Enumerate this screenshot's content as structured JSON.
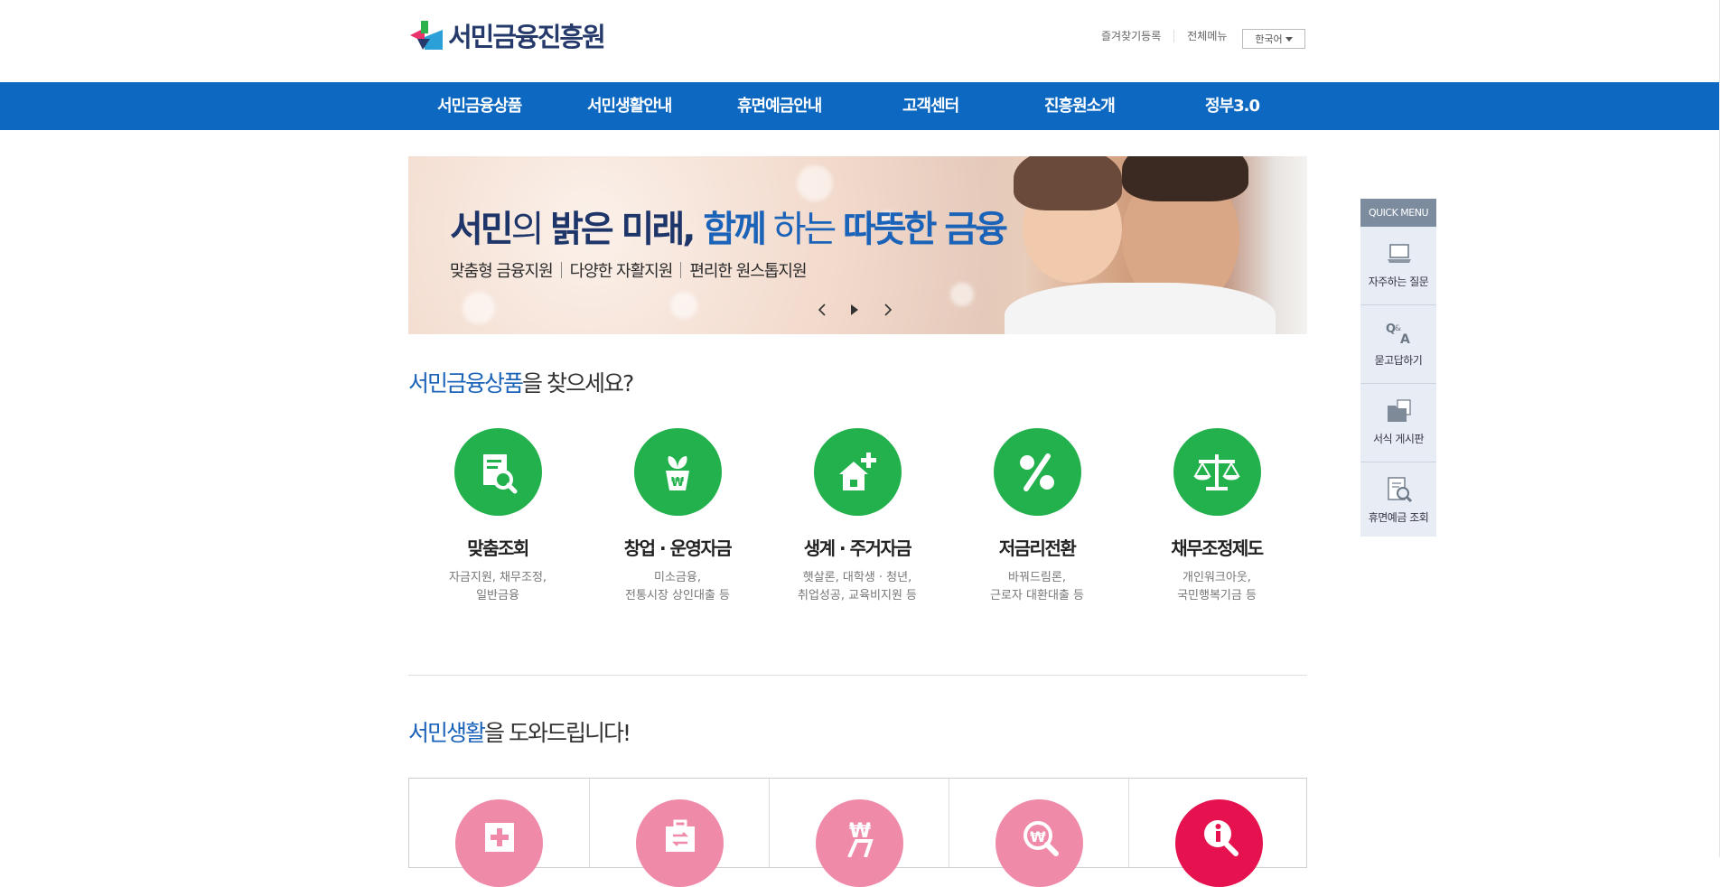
{
  "header": {
    "logo_text": "서민금융진흥원",
    "util": {
      "bookmark": "즐겨찾기등록",
      "sitemap": "전체메뉴",
      "language": "한국어"
    }
  },
  "gnb": {
    "items": [
      {
        "label": "서민금융상품"
      },
      {
        "label": "서민생활안내"
      },
      {
        "label": "휴면예금안내"
      },
      {
        "label": "고객센터"
      },
      {
        "label": "진흥원소개"
      },
      {
        "label": "정부3.0"
      }
    ]
  },
  "banner": {
    "title": {
      "p1": "서민",
      "p2": "의 ",
      "p3": "밝은 미래, ",
      "p4": "함께",
      "p5": " 하는 ",
      "p6": "따뜻한 금융"
    },
    "sub": [
      "맞춤형 금융지원",
      "다양한 자활지원",
      "편리한 원스톱지원"
    ]
  },
  "section_products": {
    "title_highlight": "서민금융상품",
    "title_rest": "을 찾으세요?",
    "items": [
      {
        "name": "맞춤조회",
        "desc1": "자금지원, 채무조정,",
        "desc2": "일반금융",
        "icon": "document-search-icon"
      },
      {
        "name": "창업 · 운영자금",
        "desc1": "미소금융,",
        "desc2": "전통시장 상인대출 등",
        "icon": "won-plant-icon"
      },
      {
        "name": "생계 · 주거자금",
        "desc1": "햇살론, 대학생 · 청년,",
        "desc2": "취업성공, 교육비지원 등",
        "icon": "house-plus-icon"
      },
      {
        "name": "저금리전환",
        "desc1": "바꿔드림론,",
        "desc2": "근로자 대환대출 등",
        "icon": "percent-icon"
      },
      {
        "name": "채무조정제도",
        "desc1": "개인워크아웃,",
        "desc2": "국민행복기금 등",
        "icon": "scale-icon"
      }
    ]
  },
  "section_life": {
    "title_highlight": "서민생활",
    "title_rest": "을 도와드립니다!"
  },
  "quick_menu": {
    "title": "QUICK MENU",
    "items": [
      {
        "label": "자주하는 질문",
        "icon": "laptop-icon"
      },
      {
        "label": "묻고답하기",
        "icon": "qna-icon"
      },
      {
        "label": "서식 게시판",
        "icon": "folder-icon"
      },
      {
        "label": "휴면예금 조회",
        "icon": "document-magnify-icon"
      }
    ]
  },
  "colors": {
    "nav_blue": "#0d68c1",
    "green": "#22b14c",
    "pink": "#ef8aa9",
    "deep_pink": "#e6124f",
    "accent_blue": "#1a63b8"
  }
}
